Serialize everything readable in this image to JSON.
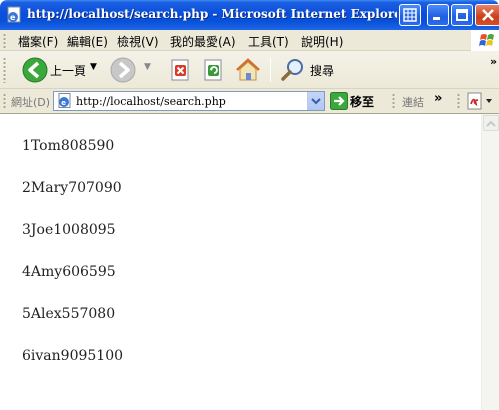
{
  "window": {
    "title": "http://localhost/search.php - Microsoft Internet Explorer"
  },
  "menu": {
    "items": [
      "檔案(F)",
      "編輯(E)",
      "檢視(V)",
      "我的最愛(A)",
      "工具(T)",
      "說明(H)"
    ]
  },
  "toolbar": {
    "back_label": "上一頁",
    "search_label": "搜尋"
  },
  "address": {
    "label": "網址(D)",
    "url": "http://localhost/search.php",
    "go_label": "移至",
    "links_label": "連結",
    "links_chevron": "»"
  },
  "content": {
    "rows": [
      "1Tom808590",
      "2Mary707090",
      "3Joe1008095",
      "4Amy606595",
      "5Alex557080",
      "6ivan9095100"
    ]
  },
  "colors": {
    "titlebar": "#0a4fdc",
    "chrome": "#ece9d8",
    "close_button": "#c8401a"
  }
}
